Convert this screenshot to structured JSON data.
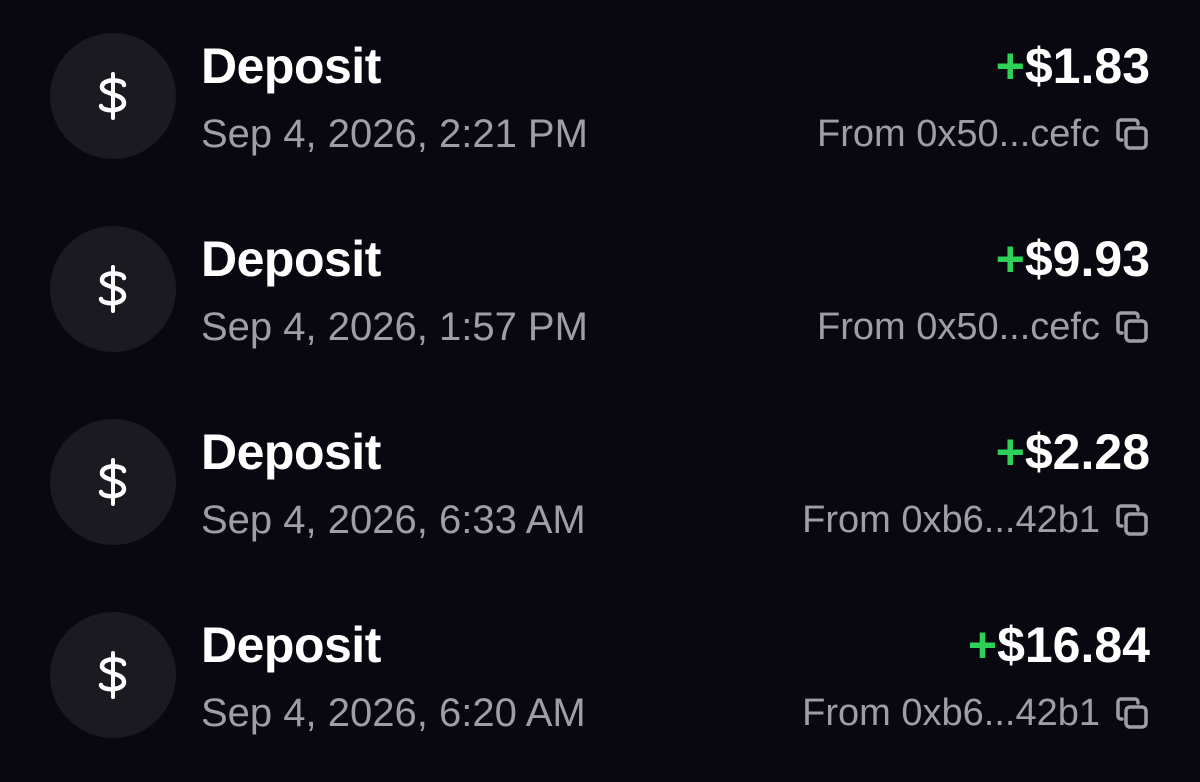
{
  "transactions": [
    {
      "type": "Deposit",
      "datetime": "Sep 4, 2026, 2:21 PM",
      "sign": "+",
      "amount": "$1.83",
      "from": "From 0x50...cefc",
      "icon": "dollar-icon"
    },
    {
      "type": "Deposit",
      "datetime": "Sep 4, 2026, 1:57 PM",
      "sign": "+",
      "amount": "$9.93",
      "from": "From 0x50...cefc",
      "icon": "dollar-icon"
    },
    {
      "type": "Deposit",
      "datetime": "Sep 4, 2026, 6:33 AM",
      "sign": "+",
      "amount": "$2.28",
      "from": "From 0xb6...42b1",
      "icon": "dollar-icon"
    },
    {
      "type": "Deposit",
      "datetime": "Sep 4, 2026, 6:20 AM",
      "sign": "+",
      "amount": "$16.84",
      "from": "From 0xb6...42b1",
      "icon": "dollar-icon"
    }
  ],
  "colors": {
    "background": "#090810",
    "avatar": "#1b1a21",
    "positive": "#2ed158",
    "primary_text": "#ffffff",
    "secondary_text": "#9f9ea6"
  }
}
